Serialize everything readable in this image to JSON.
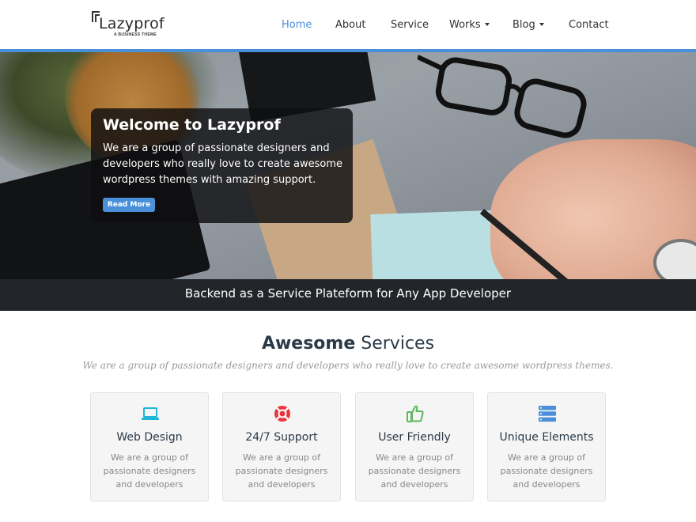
{
  "brand": {
    "name": "Lazyprof",
    "tagline": "A BUSINESS THEME"
  },
  "nav": {
    "items": [
      {
        "label": "Home",
        "active": true
      },
      {
        "label": "About"
      },
      {
        "label": "Service"
      },
      {
        "label": "Works",
        "dropdown": true
      },
      {
        "label": "Blog",
        "dropdown": true
      },
      {
        "label": "Contact"
      }
    ]
  },
  "hero": {
    "title": "Welcome to Lazyprof",
    "text": "We are a group of passionate designers and developers who really love to create awesome wordpress themes with amazing support.",
    "button": "Read More"
  },
  "strip": {
    "text": "Backend as a Service Plateform for Any App Developer"
  },
  "services": {
    "title_bold": "Awesome",
    "title_rest": "Services",
    "subtitle": "We are a group of passionate designers and developers who really love to create awesome wordpress themes.",
    "cards": [
      {
        "title": "Web Design",
        "text": "We are a group of passionate designers and developers",
        "icon": "laptop-icon",
        "color": "#1fb5d6"
      },
      {
        "title": "24/7 Support",
        "text": "We are a group of passionate designers and developers",
        "icon": "lifebuoy-icon",
        "color": "#e8363e"
      },
      {
        "title": "User Friendly",
        "text": "We are a group of passionate designers and developers",
        "icon": "thumbs-up-icon",
        "color": "#5cb85c"
      },
      {
        "title": "Unique Elements",
        "text": "We are a group of passionate designers and developers",
        "icon": "server-icon",
        "color": "#4a90d9"
      }
    ]
  },
  "colors": {
    "accent": "#4a90d9",
    "dark_strip": "#22262a"
  }
}
